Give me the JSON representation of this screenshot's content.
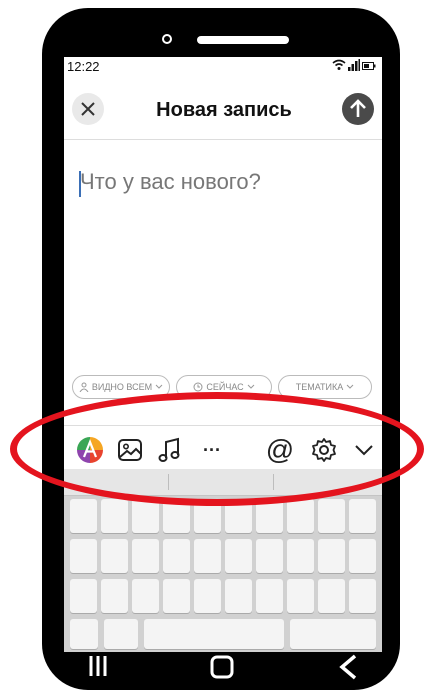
{
  "status": {
    "time": "12:22"
  },
  "header": {
    "title": "Новая запись",
    "close_icon": "close-icon",
    "send_icon": "arrow-up-icon"
  },
  "compose": {
    "placeholder": "Что у вас нового?"
  },
  "pills": [
    {
      "label": "ВИДНО ВСЕМ",
      "icon": "user-icon"
    },
    {
      "label": "СЕЙЧАС",
      "icon": "clock-icon"
    },
    {
      "label": "ТЕМАТИКА",
      "icon": ""
    }
  ],
  "toolbar": {
    "items": [
      "color-letter-icon",
      "image-icon",
      "music-icon",
      "more-icon",
      "mention-icon",
      "settings-icon",
      "chevron-down-icon"
    ]
  },
  "toolbar_text": {
    "more": "···",
    "mention": "@"
  },
  "nav": {
    "items": [
      "recent-apps-icon",
      "home-icon",
      "back-icon"
    ]
  },
  "colors": {
    "highlight": "#e4141e",
    "send_button": "#4a4a4a",
    "caret": "#3b6fb6"
  }
}
